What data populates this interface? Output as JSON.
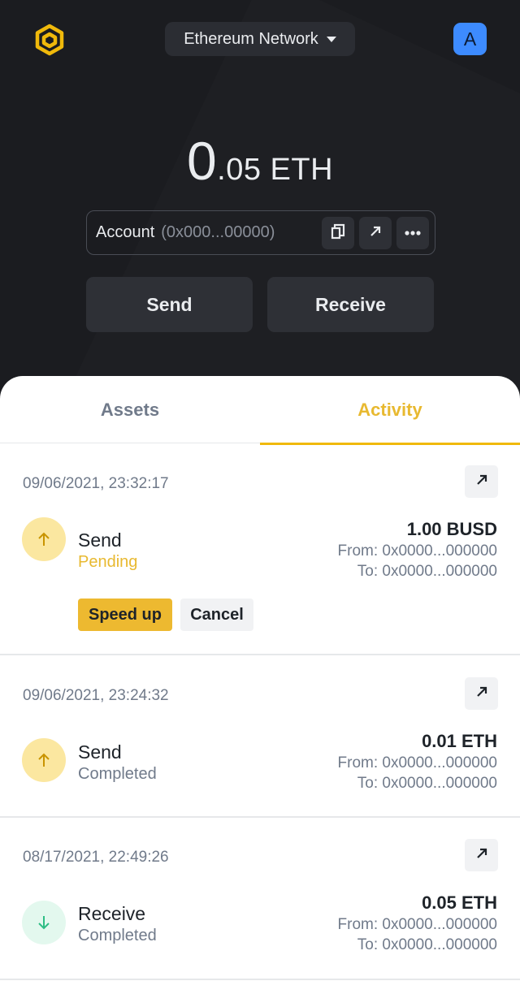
{
  "header": {
    "logo_icon": "binance-logo-icon",
    "network_label": "Ethereum Network",
    "avatar_letter": "A"
  },
  "balance": {
    "integer": "0",
    "fraction": ".05 ETH"
  },
  "account": {
    "label": "Account",
    "address": "(0x000...00000)",
    "actions": [
      "copy-icon",
      "external-link-icon",
      "more-icon"
    ]
  },
  "actions": {
    "send_label": "Send",
    "receive_label": "Receive"
  },
  "tabs": {
    "assets_label": "Assets",
    "activity_label": "Activity",
    "active": "Activity"
  },
  "colors": {
    "accent": "#f0b90b",
    "pending": "#e8b930",
    "receive": "#2ebd85"
  },
  "transactions": [
    {
      "time": "09/06/2021, 23:32:17",
      "type": "Send",
      "status": "Pending",
      "amount": "1.00 BUSD",
      "from": "From: 0x0000...000000",
      "to": "To: 0x0000...000000",
      "speed_up_label": "Speed up",
      "cancel_label": "Cancel"
    },
    {
      "time": "09/06/2021, 23:24:32",
      "type": "Send",
      "status": "Completed",
      "amount": "0.01 ETH",
      "from": "From: 0x0000...000000",
      "to": "To: 0x0000...000000"
    },
    {
      "time": "08/17/2021, 22:49:26",
      "type": "Receive",
      "status": "Completed",
      "amount": "0.05 ETH",
      "from": "From: 0x0000...000000",
      "to": "To: 0x0000...000000"
    }
  ]
}
